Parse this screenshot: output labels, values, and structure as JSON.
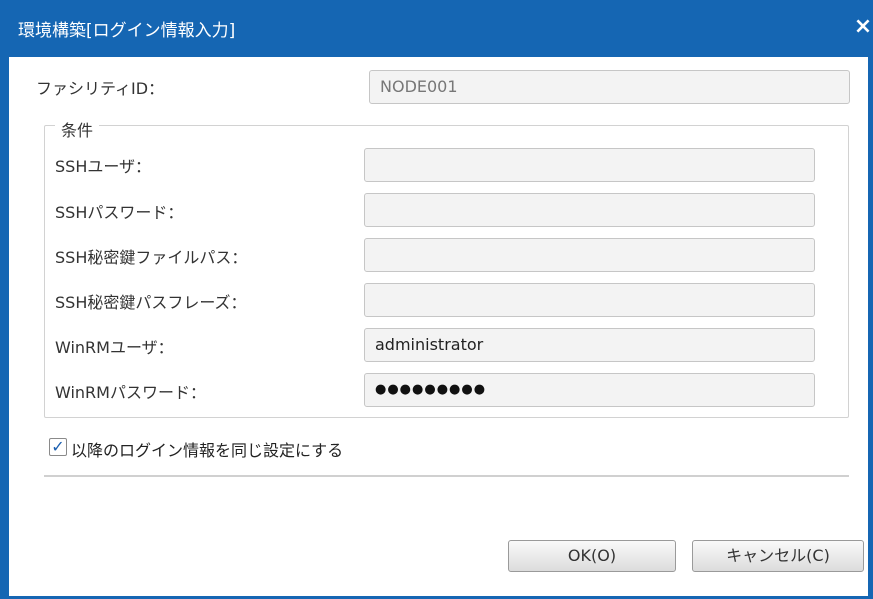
{
  "dialog": {
    "title": "環境構築[ログイン情報入力]",
    "close_symbol": "×"
  },
  "facility": {
    "label": "ファシリティID：",
    "value": "NODE001"
  },
  "conditions": {
    "legend": "条件",
    "fields": [
      {
        "label": "SSHユーザ：",
        "value": ""
      },
      {
        "label": "SSHパスワード：",
        "value": ""
      },
      {
        "label": "SSH秘密鍵ファイルパス：",
        "value": ""
      },
      {
        "label": "SSH秘密鍵パスフレーズ：",
        "value": ""
      },
      {
        "label": "WinRMユーザ：",
        "value": "administrator"
      },
      {
        "label": "WinRMパスワード：",
        "value": "●●●●●●●●●"
      }
    ]
  },
  "options": {
    "same_login_checked": true,
    "check_mark": "✓",
    "same_login_label": "以降のログイン情報を同じ設定にする"
  },
  "buttons": {
    "ok": "OK(O)",
    "cancel": "キャンセル(C)"
  },
  "colors": {
    "titlebar": "#1566b3",
    "checkmark": "#1b5fb0"
  }
}
